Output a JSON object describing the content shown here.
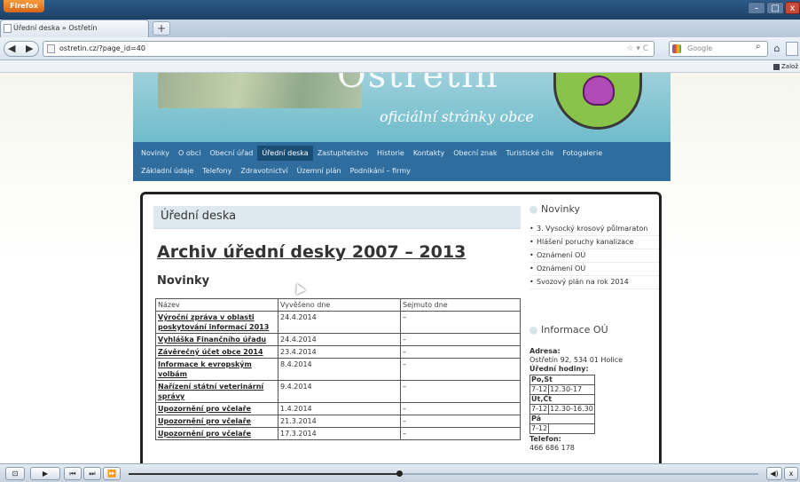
{
  "browser": {
    "menu_button": "Firefox",
    "tab_title": "Úřední deska » Ostřetín",
    "new_tab": "+",
    "url": "ostretin.cz/?page_id=40",
    "url_icons": "☆ ▾ C",
    "search_placeholder": "Google",
    "bookmarks_label": "Založ",
    "window_controls": {
      "minimize": "–",
      "maximize": "□",
      "close": "x"
    }
  },
  "site": {
    "title": "Ostřetín",
    "subtitle": "oficiální stránky obce",
    "menu_row1": [
      "Novinky",
      "O obci",
      "Obecní úřad",
      "Úřední deska",
      "Zastupitelstvo",
      "Historie",
      "Kontakty",
      "Obecní znak",
      "Turistické cíle",
      "Fotogalerie"
    ],
    "menu_row2": [
      "Základní údaje",
      "Telefony",
      "Zdravotnictví",
      "Územní plán",
      "Podnikání – firmy"
    ],
    "active_menu_item": "Úřední deska"
  },
  "content": {
    "box_title": "Úřední deska",
    "archive_title": "Archiv úřední desky 2007 – 2013",
    "section_title": "Novinky",
    "table_headers": [
      "Název",
      "Vyvěšeno dne",
      "Sejmuto dne"
    ],
    "rows": [
      {
        "name": "Výroční zpráva v oblasti poskytování informací 2013",
        "posted": "24.4.2014",
        "removed": "–"
      },
      {
        "name": "Vyhláška Finančního úřadu",
        "posted": "24.4.2014",
        "removed": "–"
      },
      {
        "name": "Závěrečný účet obce 2014",
        "posted": "23.4.2014",
        "removed": "–"
      },
      {
        "name": "Informace k evropským volbám",
        "posted": "8.4.2014",
        "removed": "–"
      },
      {
        "name": "Nařízení státní veterinární správy",
        "posted": "9.4.2014",
        "removed": "–"
      },
      {
        "name": "Upozornění pro včelaře",
        "posted": "1.4.2014",
        "removed": "–"
      },
      {
        "name": "Upozornění pro včelaře",
        "posted": "21.3.2014",
        "removed": "–"
      },
      {
        "name": "Upozornění pro včelaře",
        "posted": "17.3.2014",
        "removed": "–"
      }
    ]
  },
  "sidebar": {
    "news_title": "Novinky",
    "news_items": [
      "3. Vysocký krosový půlmaraton",
      "Hlášení poruchy kanalizace",
      "Oznámení OÚ",
      "Oznámení OÚ",
      "Svozový plán na rok 2014"
    ],
    "info_title": "Informace OÚ",
    "address_label": "Adresa:",
    "address": "Ostřetín 92, 534 01 Holice",
    "hours_label": "Úřední hodiny:",
    "hours": [
      {
        "day": "Po,St",
        "time1": "7-12",
        "time2": "12.30-17"
      },
      {
        "day": "Út,Čt",
        "time1": "7-12",
        "time2": "12.30-16.30"
      },
      {
        "day": "Pá",
        "time1": "7-12",
        "time2": ""
      }
    ],
    "phone_label": "Telefon:",
    "phone": "466 686 178"
  },
  "player": {
    "progress": 0.43
  }
}
